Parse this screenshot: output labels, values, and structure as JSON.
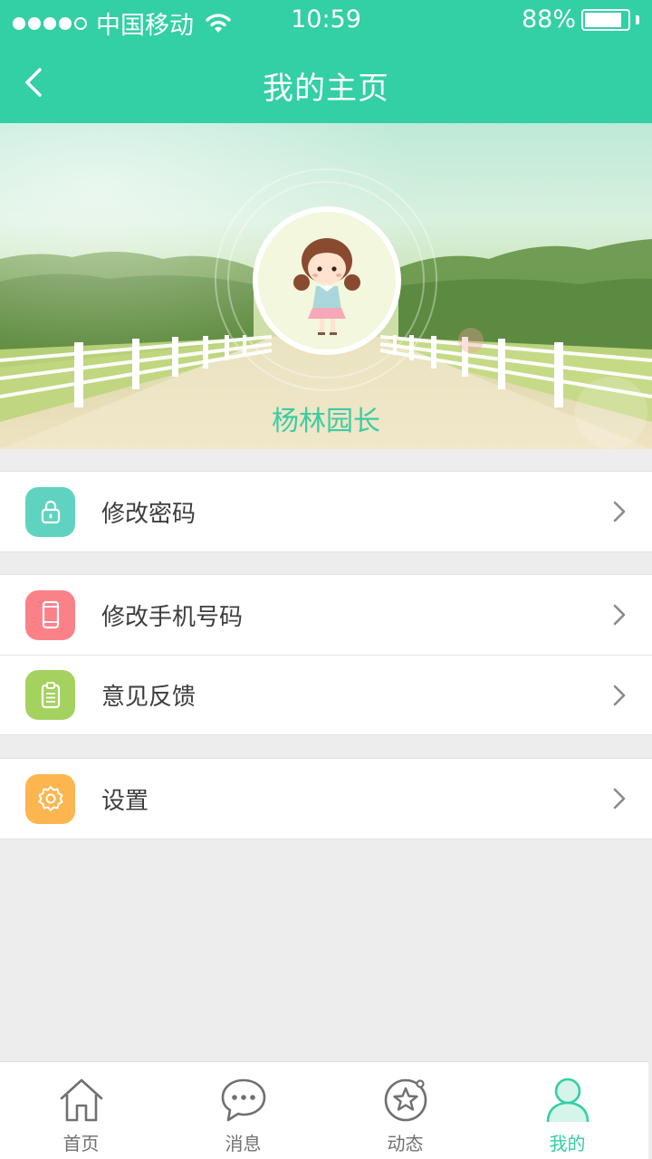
{
  "status_bar": {
    "carrier": "中国移动",
    "time": "10:59",
    "battery": "88%",
    "battery_level": 0.88,
    "signal_bars_filled": 4,
    "signal_bars_total": 5
  },
  "nav": {
    "title": "我的主页",
    "back_icon": "chevron-left-icon"
  },
  "profile": {
    "name": "杨林园长",
    "avatar_icon": "girl-avatar-icon"
  },
  "menu_groups": [
    {
      "items": [
        {
          "label": "修改密码",
          "icon": "lock-icon",
          "color": "#5fd3c0"
        }
      ]
    },
    {
      "items": [
        {
          "label": "修改手机号码",
          "icon": "phone-icon",
          "color": "#fb8189"
        },
        {
          "label": "意见反馈",
          "icon": "clipboard-icon",
          "color": "#a4d25f"
        }
      ]
    },
    {
      "items": [
        {
          "label": "设置",
          "icon": "gear-icon",
          "color": "#fdb64f"
        }
      ]
    }
  ],
  "tabs": [
    {
      "label": "首页",
      "icon": "home-icon",
      "active": false
    },
    {
      "label": "消息",
      "icon": "message-icon",
      "active": false
    },
    {
      "label": "动态",
      "icon": "star-orbit-icon",
      "active": false
    },
    {
      "label": "我的",
      "icon": "person-icon",
      "active": true
    }
  ],
  "colors": {
    "primary": "#33cfa5",
    "background": "#ededed",
    "tab_inactive": "#707070"
  }
}
